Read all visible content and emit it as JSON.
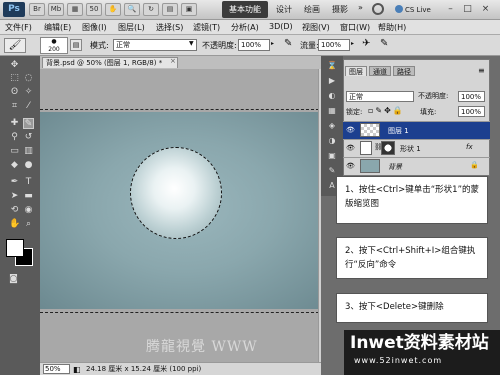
{
  "titlebar": {
    "logo": "Ps",
    "workspace_active": "基本功能",
    "workspace_items": [
      "设计",
      "绘画",
      "摄影"
    ],
    "more": "»",
    "cs_live": "CS Live",
    "minimize": "–",
    "maximize": "□",
    "close": "×"
  },
  "menubar": {
    "items": [
      "文件(F)",
      "编辑(E)",
      "图像(I)",
      "图层(L)",
      "选择(S)",
      "滤镜(T)",
      "分析(A)",
      "3D(D)",
      "视图(V)",
      "窗口(W)",
      "帮助(H)"
    ]
  },
  "options": {
    "brush_size": "200",
    "mode_label": "模式:",
    "mode_value": "正常",
    "opacity_label": "不透明度:",
    "opacity_value": "100%",
    "flow_label": "流量:",
    "flow_value": "100%"
  },
  "document": {
    "tab_title": "背景.psd @ 50% (图层 1, RGB/8) *",
    "tab_close": "×",
    "zoom": "50%",
    "info": "24.18 厘米 x 15.24 厘米 (100 ppi)",
    "watermark": "腾龍視覺 WWW"
  },
  "layers_panel": {
    "tabs": [
      "图层",
      "通道",
      "路径"
    ],
    "blend_mode": "正常",
    "opacity_label": "不透明度:",
    "opacity_value": "100%",
    "lock_label": "锁定:",
    "fill_label": "填充:",
    "fill_value": "100%",
    "layers": [
      {
        "name": "图层 1",
        "selected": true
      },
      {
        "name": "形状 1",
        "selected": false,
        "fx": "fx"
      },
      {
        "name": "背景",
        "selected": false
      }
    ]
  },
  "instructions": [
    "1、按住<Ctrl>键单击“形状1”的蒙版缩览图",
    "2、按下<Ctrl+Shift+I>组合键执行“反向”命令",
    "3、按下<Delete>键删除"
  ],
  "brand": {
    "name": "Inwet资料素材站",
    "url": "www.52inwet.com"
  },
  "colors": {
    "selected_layer": "#1c3f8f",
    "brand_bg": "#1c1c1c",
    "image_bg": "#8aa7ad"
  }
}
